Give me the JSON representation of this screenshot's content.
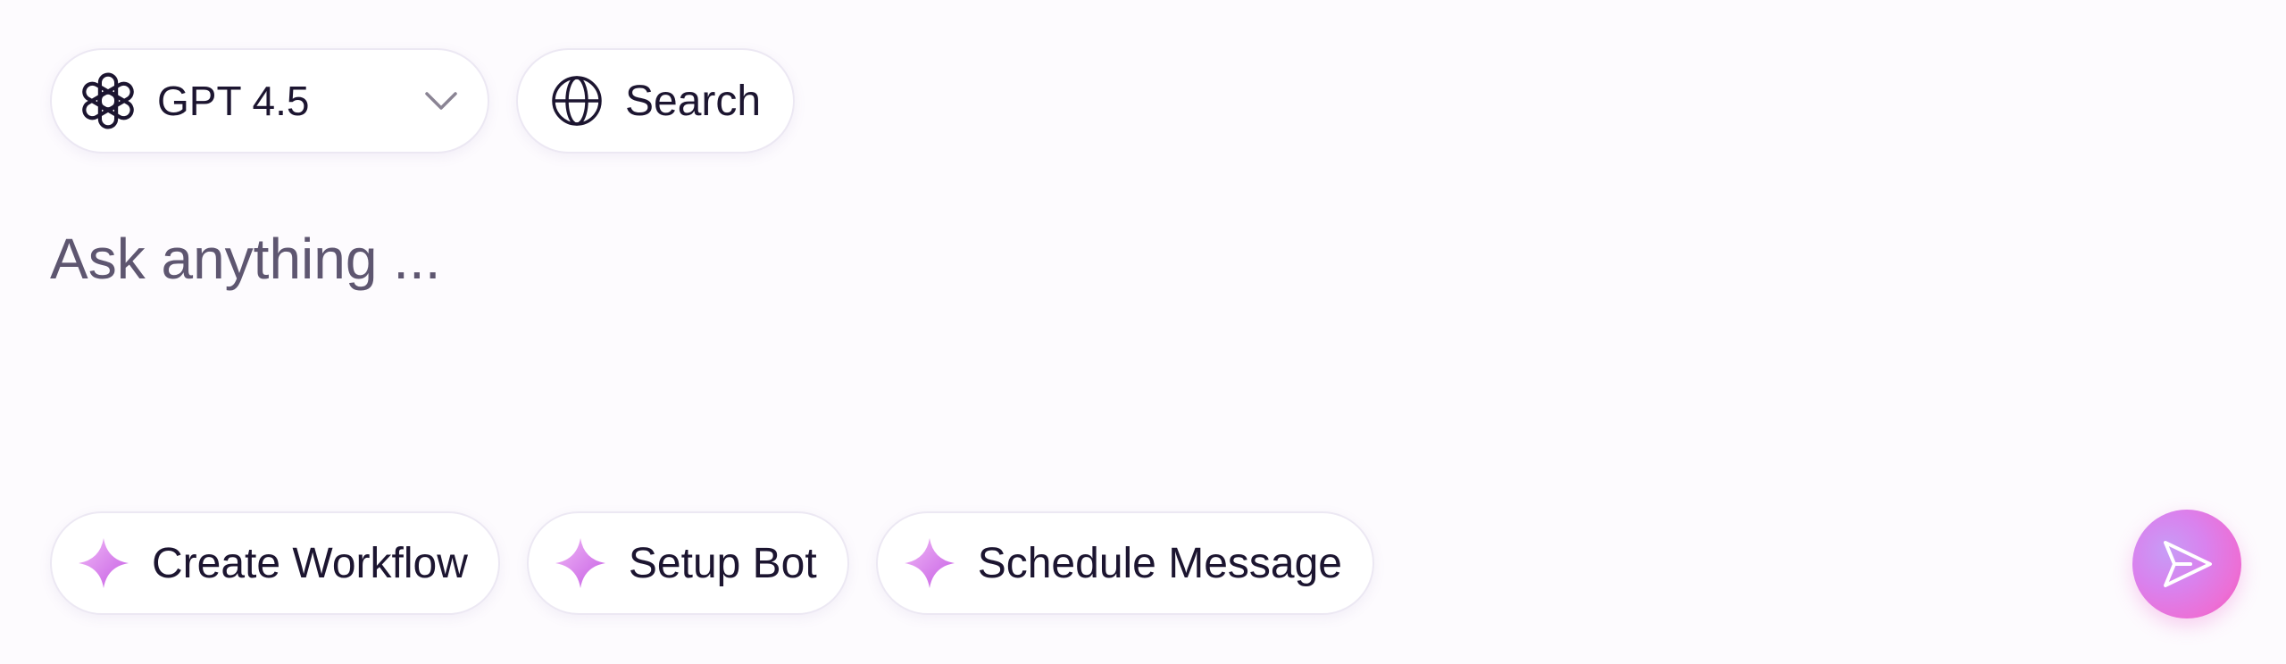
{
  "model_selector": {
    "label": "GPT 4.5",
    "icon": "openai-logo-icon"
  },
  "search_toggle": {
    "label": "Search",
    "icon": "globe-icon"
  },
  "prompt": {
    "placeholder": "Ask anything ...",
    "value": ""
  },
  "suggestions": [
    {
      "label": "Create Workflow",
      "icon": "sparkle-icon"
    },
    {
      "label": "Setup Bot",
      "icon": "sparkle-icon"
    },
    {
      "label": "Schedule Message",
      "icon": "sparkle-icon"
    }
  ],
  "send": {
    "icon": "send-icon"
  },
  "colors": {
    "accent_start": "#c79cf6",
    "accent_end": "#f14fb3",
    "sparkle": "#d77fe9",
    "text": "#1c1530",
    "placeholder": "#5e5670",
    "pill_border": "#ece8f3"
  }
}
